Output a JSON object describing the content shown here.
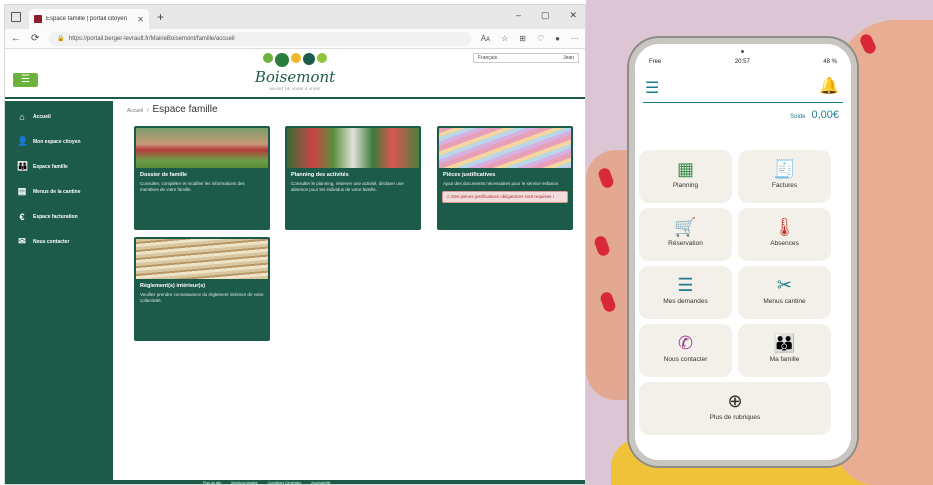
{
  "browser": {
    "tab_title": "Espace famille | portail citoyen",
    "tab_close": "✕",
    "new_tab": "+",
    "window_controls": [
      "–",
      "▢",
      "✕"
    ],
    "url": "https://portail.berger-levrault.fr/MairieBoisemont/famille/accueil",
    "nav": {
      "back": "←",
      "reload": "⟳",
      "lock": "🔒"
    },
    "addr_icons": [
      "Aᴀ",
      "☆",
      "⊞",
      "♡",
      "●",
      "···"
    ]
  },
  "site": {
    "menu_glyph": "☰",
    "logo_text": "Boisemont",
    "logo_sub": "UN ART DE VIVRE À VIVRE",
    "language": "Français",
    "account": "Jean",
    "breadcrumb_home": "Accueil",
    "breadcrumb_sep": "/",
    "page_title": "Espace famille",
    "sidebar": [
      {
        "icon": "⌂",
        "label": "Accueil"
      },
      {
        "icon": "👤",
        "label": "Mon espace citoyen"
      },
      {
        "icon": "👪",
        "label": "Espace famille"
      },
      {
        "icon": "▤",
        "label": "Menus de la cantine"
      },
      {
        "icon": "€",
        "label": "Espace facturation"
      },
      {
        "icon": "✉",
        "label": "Nous contacter"
      }
    ],
    "cards": [
      {
        "title": "Dossier de famille",
        "desc": "Consulter, compléter et modifier les informations des membres de votre famille."
      },
      {
        "title": "Planning des activités",
        "desc": "Consulter le planning, réserver une activité, déclarer une absence pour les individus de votre famille."
      },
      {
        "title": "Pièces justificatives",
        "desc": "Ajout des documents nécessaires pour le service enfance.",
        "alert": "⚠ Des pièces justificatives obligatoires sont requises !"
      },
      {
        "title": "Règlement(s) intérieur(s)",
        "desc": "Veuillez prendre connaissance du règlement intérieur de votre collectivité."
      }
    ],
    "footer_links": [
      "Plan du site",
      "Mentions légales",
      "Conditions Générales",
      "Accessibilité"
    ]
  },
  "phone": {
    "carrier": "Free",
    "time": "20:57",
    "battery": "48 %",
    "menu_glyph": "☰",
    "bell_glyph": "🔔",
    "solde_label": "Solde",
    "solde_value": "0,00€",
    "tiles": [
      {
        "icon": "▦",
        "label": "Planning",
        "color": "#3c8f4a"
      },
      {
        "icon": "🧾",
        "label": "Factures",
        "color": "#d2872c"
      },
      {
        "icon": "🛒",
        "label": "Réservation",
        "color": "#e0b52a"
      },
      {
        "icon": "🌡",
        "label": "Absences",
        "color": "#c0392b"
      },
      {
        "icon": "☰",
        "label": "Mes demandes",
        "color": "#1d7d8f"
      },
      {
        "icon": "✂",
        "label": "Menus cantine",
        "color": "#1d7d8f"
      },
      {
        "icon": "✆",
        "label": "Nous contacter",
        "color": "#9b3c8f"
      },
      {
        "icon": "👪",
        "label": "Ma famille",
        "color": "#d2872c"
      },
      {
        "icon": "⊕",
        "label": "Plus de rubriques",
        "color": "#2b2b2b"
      }
    ]
  },
  "colors": {
    "site_green": "#1c5a4a",
    "menu_green": "#6bb33a",
    "app_teal": "#1d7d8f"
  }
}
